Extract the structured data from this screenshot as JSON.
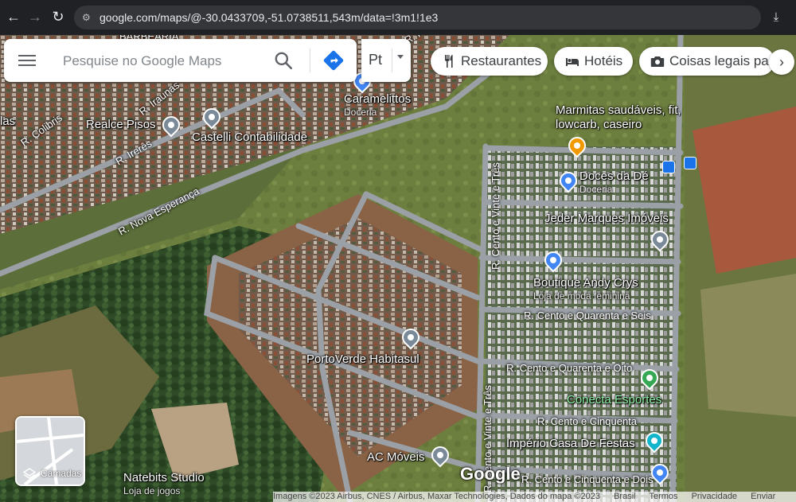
{
  "browser": {
    "url": "google.com/maps/@-30.0433709,-51.0738511,543m/data=!3m1!1e3"
  },
  "search": {
    "placeholder": "Pesquise no Google Maps",
    "language_label": "Pt"
  },
  "chips": [
    {
      "label": "Restaurantes",
      "icon": "fork-knife-icon"
    },
    {
      "label": "Hotéis",
      "icon": "bed-icon"
    },
    {
      "label": "Coisas legais par",
      "icon": "camera-icon"
    }
  ],
  "places": [
    {
      "name": "Caramelittos",
      "category": "Doceria",
      "pin_color": "#4285f4",
      "icon": "cake-pin-icon"
    },
    {
      "name": "Realce Pisos",
      "category": "",
      "pin_color": "#7b8a99",
      "icon": "gray-pin-icon"
    },
    {
      "name": "Castelli Contabilidade",
      "category": "",
      "pin_color": "#7b8a99",
      "icon": "gray-pin-icon"
    },
    {
      "name": "Marmitas saudáveis, fit, lowcarb, caseiro",
      "category": "",
      "pin_color": "#f29900",
      "icon": "fork-pin-icon"
    },
    {
      "name": "Doces da Dé",
      "category": "Doceria",
      "pin_color": "#4285f4",
      "icon": "cake-pin-icon"
    },
    {
      "name": "Jeder Marques Imóveis",
      "category": "",
      "pin_color": "#7b8a99",
      "icon": "gray-pin-icon"
    },
    {
      "name": "Boutique Andy Crys",
      "category": "Loja de moda feminina",
      "pin_color": "#4285f4",
      "icon": "shopping-pin-icon"
    },
    {
      "name": "PortoVerde Habitasul",
      "category": "",
      "pin_color": "#7b8a99",
      "icon": "gray-pin-icon"
    },
    {
      "name": "Conecta Esportes",
      "category": "",
      "pin_color": "#34a853",
      "icon": "green-pin-icon"
    },
    {
      "name": "Império Casa De Festas",
      "category": "",
      "pin_color": "#12b5cb",
      "icon": "event-pin-icon"
    },
    {
      "name": "AC Móveis",
      "category": "",
      "pin_color": "#7b8a99",
      "icon": "gray-pin-icon"
    },
    {
      "name": "Natebits Studio",
      "category": "Loja de jogos",
      "pin_color": "#4285f4",
      "icon": "game-pin-icon"
    }
  ],
  "streets": [
    "R. Colibris",
    "R. Iraunas",
    "R. Irerês",
    "R. Nova Esperança",
    "R. Cento e Vinte e Três",
    "R. Cento e Quarenta e Seis",
    "R. Cento e Quarenta e Oito",
    "R. Cento e Cinquenta",
    "R. Cento e Cinquenta e Dois",
    "R. Cento e Vinte e Três",
    "las",
    "BARBEARIA",
    "R. Pa"
  ],
  "layers": {
    "label": "Camadas"
  },
  "logo": "Google",
  "footer": {
    "attribution": "Imagens ©2023 Airbus, CNES / Airbus, Maxar Technologies, Dados do mapa ©2023",
    "links": [
      "Brasil",
      "Termos",
      "Privacidade",
      "Enviar"
    ]
  },
  "colors": {
    "pin_blue": "#4285f4",
    "pin_gray": "#7b8a99",
    "pin_orange": "#f29900",
    "pin_green": "#34a853",
    "pin_teal": "#12b5cb",
    "road": "#9aa0a6"
  }
}
